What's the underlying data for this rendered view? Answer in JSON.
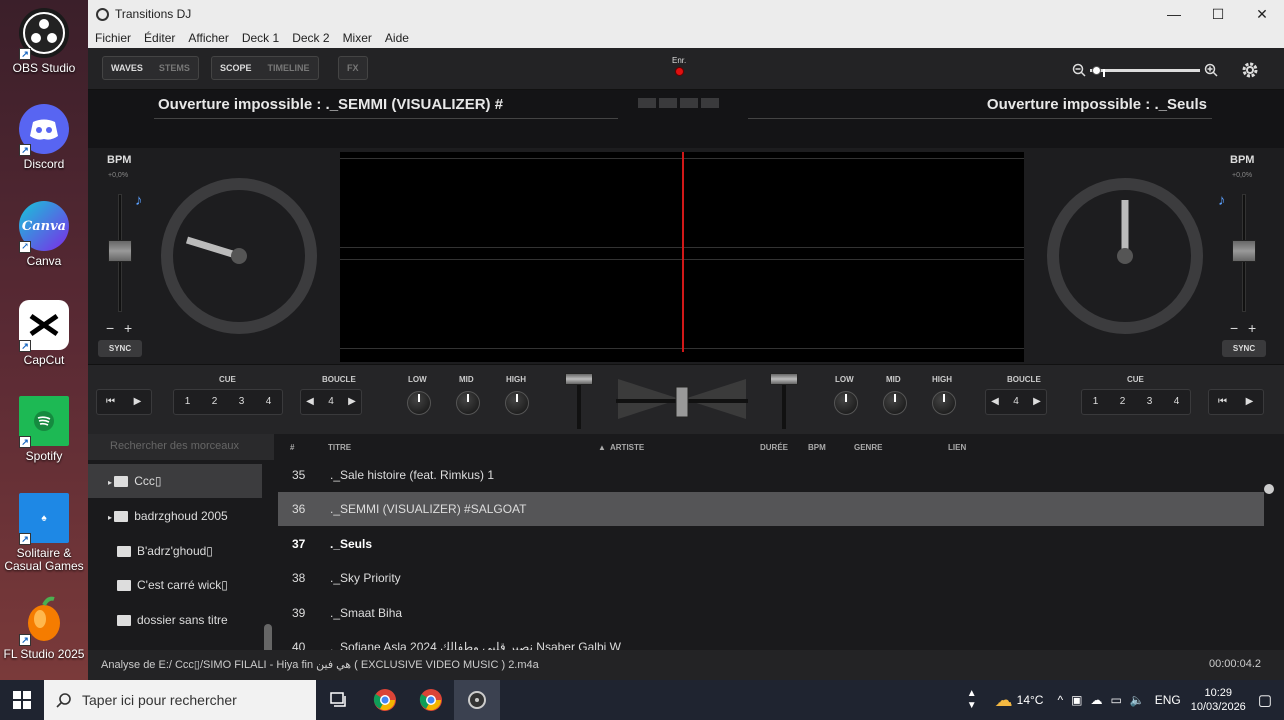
{
  "window": {
    "title": "Transitions DJ",
    "min": "—",
    "max": "☐",
    "close": "✕"
  },
  "menu": [
    "Fichier",
    "Éditer",
    "Afficher",
    "Deck 1",
    "Deck 2",
    "Mixer",
    "Aide"
  ],
  "toolbar": {
    "waves": "WAVES",
    "stems": "STEMS",
    "scope": "SCOPE",
    "timeline": "TIMELINE",
    "fx": "FX",
    "rec_label": "Enr.",
    "zoom_level_percent": 5
  },
  "deck_titles": {
    "left": "Ouverture impossible : ._SEMMI (VISUALIZER) #",
    "right": "Ouverture impossible : ._Seuls"
  },
  "deckL": {
    "bpm": "BPM",
    "pitch": "+0,0%",
    "minus": "−",
    "plus": "+",
    "sync": "SYNC"
  },
  "deckR": {
    "bpm": "BPM",
    "pitch": "+0,0%",
    "minus": "−",
    "plus": "+",
    "sync": "SYNC"
  },
  "transport": {
    "cue": "CUE",
    "loop": "BOUCLE",
    "low": "LOW",
    "mid": "MID",
    "high": "HIGH",
    "cue_buttons": [
      "1",
      "2",
      "3",
      "4"
    ],
    "loop_value": "4",
    "prev": "◀",
    "next": "▶"
  },
  "library": {
    "search_placeholder": "Rechercher des morceaux",
    "columns": {
      "num": "#",
      "title": "TITRE",
      "artist": "ARTISTE",
      "duration": "DURÉE",
      "bpm": "BPM",
      "genre": "GENRE",
      "link": "LIEN"
    },
    "folders": [
      "Ccc▯",
      "badrzghoud 2005",
      "B'adrz'ghoud▯",
      "C'est carré wick▯",
      "dossier sans titre"
    ],
    "tracks": [
      {
        "num": "35",
        "title": "._Sale histoire (feat. Rimkus) 1"
      },
      {
        "num": "36",
        "title": "._SEMMI (VISUALIZER) #SALGOAT"
      },
      {
        "num": "37",
        "title": "._Seuls"
      },
      {
        "num": "38",
        "title": "._Sky Priority"
      },
      {
        "num": "39",
        "title": "._Smaat Biha"
      },
      {
        "num": "40",
        "title": "._Sofiane Asla 2024 نصبر قلبي وطفالك Nsaber Galbi W"
      }
    ]
  },
  "status": {
    "left": "Analyse de E:/ Ccc▯/SIMO FILALI - Hiya fin هي فين ( EXCLUSIVE VIDEO MUSIC ) 2.m4a",
    "right": "00:00:04.2"
  },
  "desktop_icons": [
    {
      "label": "OBS Studio",
      "color": "#1a1a1a"
    },
    {
      "label": "Discord",
      "color": "#5865f2"
    },
    {
      "label": "Canva",
      "color": "#16a3c9"
    },
    {
      "label": "CapCut",
      "color": "#ffffff"
    },
    {
      "label": "Spotify",
      "color": "#1db954"
    },
    {
      "label": "Solitaire & Casual Games",
      "color": "#1e88e5"
    },
    {
      "label": "FL Studio 2025",
      "color": "#f57c00"
    }
  ],
  "taskbar": {
    "search_placeholder": "Taper ici pour rechercher",
    "temp": "14°C",
    "lang": "ENG",
    "time": "10:29",
    "date": "10/03/2026"
  }
}
